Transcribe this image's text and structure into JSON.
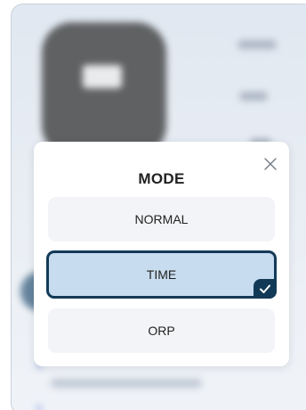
{
  "modal": {
    "title": "MODE",
    "close_icon": "close-icon",
    "options": [
      {
        "label": "NORMAL",
        "selected": false
      },
      {
        "label": "TIME",
        "selected": true
      },
      {
        "label": "ORP",
        "selected": false
      }
    ],
    "check_icon": "checkmark-icon"
  },
  "colors": {
    "selected_fill": "#c7dcee",
    "selected_border": "#123a57",
    "option_fill": "#f3f4f7"
  }
}
